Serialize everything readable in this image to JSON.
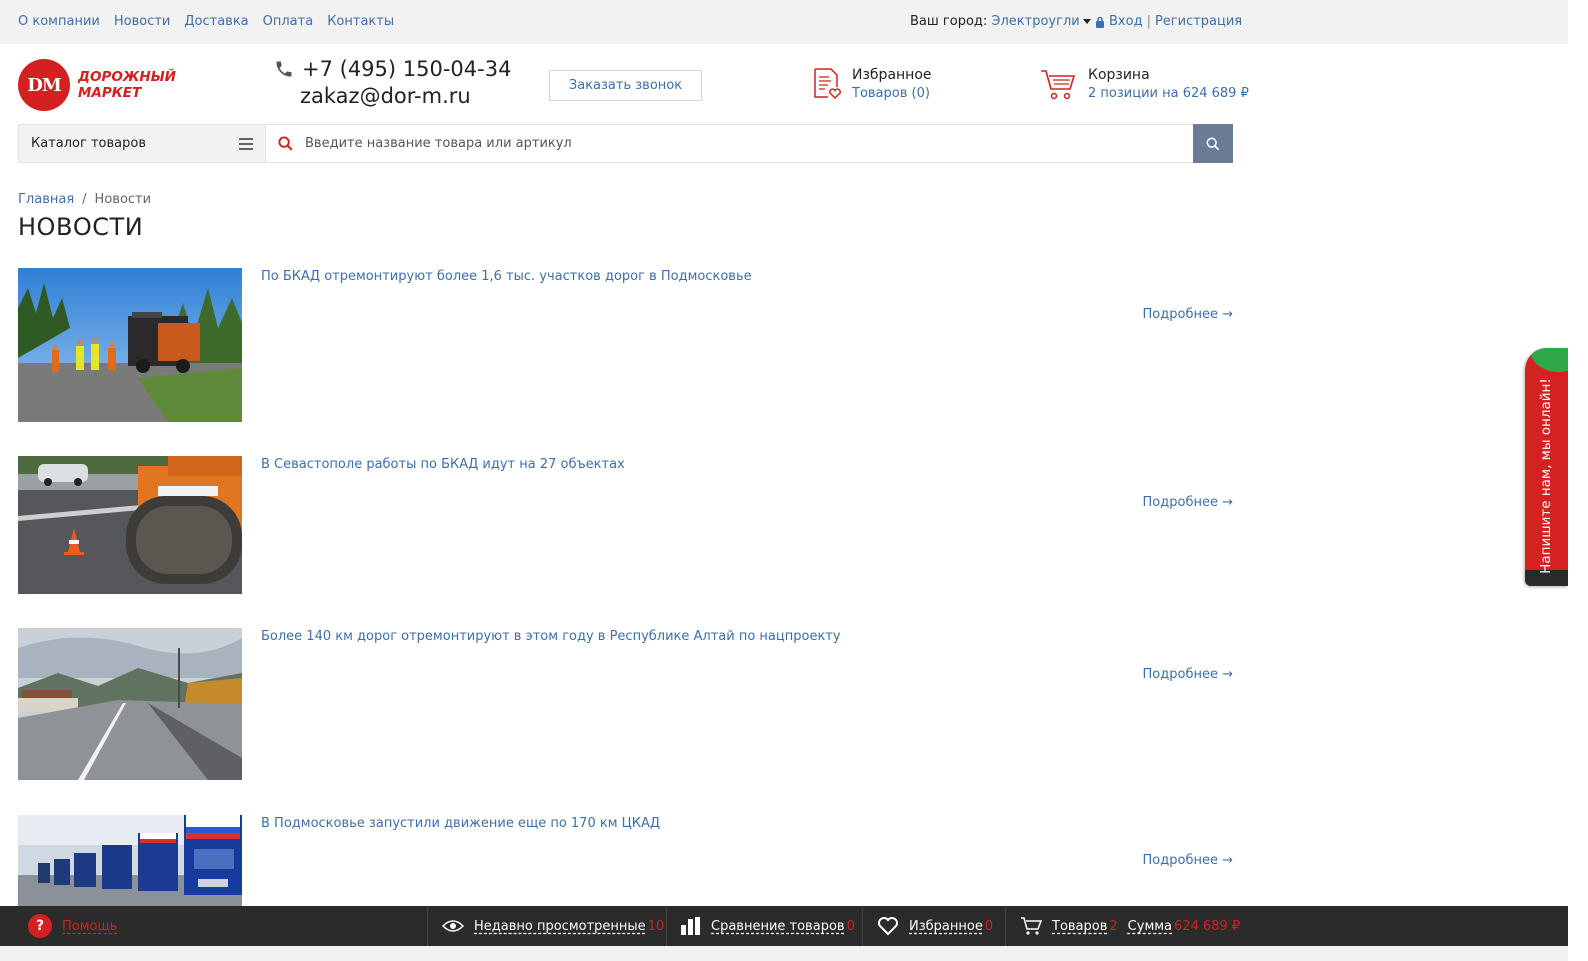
{
  "topbar": {
    "nav": [
      "О компании",
      "Новости",
      "Доставка",
      "Оплата",
      "Контакты"
    ],
    "city_label": "Ваш город:",
    "city_value": "Электроугли",
    "login": "Вход",
    "separator": "|",
    "register": "Регистрация"
  },
  "header": {
    "logo_mark": "DM",
    "logo_line1": "ДОРОЖНЫЙ",
    "logo_line2": "МАРКЕТ",
    "phone": "+7 (495) 150-04-34",
    "email": "zakaz@dor-m.ru",
    "callback_label": "Заказать звонок",
    "favorites_title": "Избранное",
    "favorites_sub": "Товаров (0)",
    "cart_title": "Корзина",
    "cart_sub": "2 позиции на 624 689 ₽"
  },
  "search": {
    "catalog_label": "Каталог товаров",
    "placeholder": "Введите название товара или артикул"
  },
  "breadcrumb": {
    "home": "Главная",
    "separator": "/",
    "current": "Новости"
  },
  "page_title": "НОВОСТИ",
  "news": [
    {
      "title": "По БКАД отремонтируют более 1,6 тыс. участков дорог в Подмосковье",
      "more": "Подробнее →"
    },
    {
      "title": "В Севастополе работы по БКАД идут на 27 объектах",
      "more": "Подробнее →"
    },
    {
      "title": "Более 140 км дорог отремонтируют в этом году в Республике Алтай по нацпроекту",
      "more": "Подробнее →"
    },
    {
      "title": "В Подмосковье запустили движение еще по 170 км ЦКАД",
      "more": "Подробнее →"
    }
  ],
  "chat_label": "Напишите нам, мы онлайн!",
  "bottombar": {
    "help": "Помощь",
    "recent": "Недавно просмотренные",
    "recent_count": "10",
    "compare": "Сравнение товаров",
    "compare_count": "0",
    "favorites": "Избранное",
    "favorites_count": "0",
    "goods": "Товаров",
    "goods_count": "2",
    "sum": "Сумма",
    "sum_value": "624 689 ₽"
  },
  "colors": {
    "brand_red": "#d42020",
    "link_blue": "#3d6fa8",
    "search_button": "#6b7b95",
    "bottombar_bg": "#2b2b2b"
  }
}
